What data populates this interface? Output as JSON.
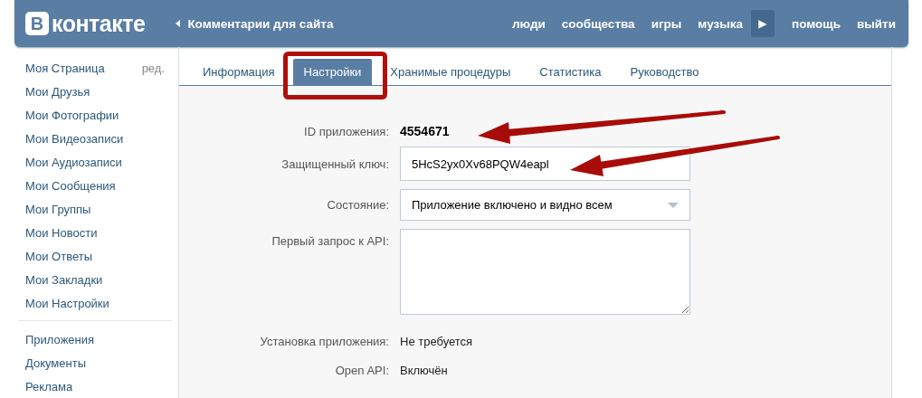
{
  "header": {
    "logo_mark": "В",
    "logo_text": "контакте",
    "back_link": "Комментарии для сайта",
    "nav": [
      {
        "label": "люди",
        "kind": "link"
      },
      {
        "label": "сообщества",
        "kind": "link"
      },
      {
        "label": "игры",
        "kind": "link"
      },
      {
        "label": "музыка",
        "kind": "link"
      },
      {
        "label": "▶",
        "kind": "play"
      },
      {
        "label": "помощь",
        "kind": "link"
      },
      {
        "label": "выйти",
        "kind": "link"
      }
    ]
  },
  "sidebar": {
    "edit_link": "ред.",
    "groups": [
      {
        "items": [
          "Моя Страница",
          "Мои Друзья",
          "Мои Фотографии",
          "Мои Видеозаписи",
          "Мои Аудиозаписи",
          "Мои Сообщения",
          "Мои Группы",
          "Мои Новости",
          "Мои Ответы",
          "Мои Закладки",
          "Мои Настройки"
        ]
      },
      {
        "items": [
          "Приложения",
          "Документы",
          "Реклама"
        ]
      }
    ]
  },
  "tabs": [
    {
      "label": "Информация",
      "selected": false
    },
    {
      "label": "Настройки",
      "selected": true
    },
    {
      "label": "Хранимые процедуры",
      "selected": false
    },
    {
      "label": "Статистика",
      "selected": false
    },
    {
      "label": "Руководство",
      "selected": false
    }
  ],
  "form": [
    {
      "label": "ID приложения:",
      "kind": "bold",
      "value": "4554671"
    },
    {
      "label": "Защищенный ключ:",
      "kind": "input",
      "value": "5HcS2yx0Xv68PQW4eapl"
    },
    {
      "label": "Состояние:",
      "kind": "select",
      "value": "Приложение включено и видно всем"
    },
    {
      "label": "Первый запрос к API:",
      "kind": "textarea"
    },
    {
      "label": "Установка приложения:",
      "kind": "text",
      "value": "Не требуется"
    },
    {
      "label": "Open API:",
      "kind": "text",
      "value": "Включён"
    }
  ]
}
